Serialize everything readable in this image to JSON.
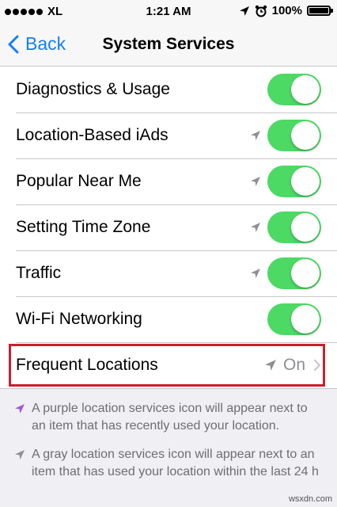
{
  "status_bar": {
    "carrier": "XL",
    "time": "1:21 AM",
    "battery": "100%",
    "battery_level": 1.0
  },
  "nav": {
    "back_label": "Back",
    "title": "System Services"
  },
  "rows": [
    {
      "label": "Diagnostics & Usage",
      "location_icon": false,
      "toggle": "on"
    },
    {
      "label": "Location-Based iAds",
      "location_icon": true,
      "toggle": "on"
    },
    {
      "label": "Popular Near Me",
      "location_icon": true,
      "toggle": "on"
    },
    {
      "label": "Setting Time Zone",
      "location_icon": true,
      "toggle": "on"
    },
    {
      "label": "Traffic",
      "location_icon": true,
      "toggle": "on"
    },
    {
      "label": "Wi-Fi Networking",
      "location_icon": false,
      "toggle": "on"
    }
  ],
  "frequent_locations": {
    "label": "Frequent Locations",
    "value": "On"
  },
  "footer": {
    "purple_note": "A purple location services icon will appear next to an item that has recently used your location.",
    "gray_note": "A gray location services icon will appear next to an item that has used your location within the last 24 h"
  },
  "watermark": "wsxdn.com",
  "colors": {
    "accent": "#157efb",
    "toggle_on": "#4cd964",
    "highlight": "#c62030",
    "purple_icon": "#a259d9",
    "gray_icon": "#8e8e93"
  }
}
